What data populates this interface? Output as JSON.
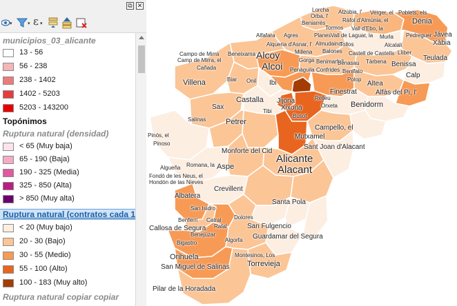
{
  "panel": {
    "window_buttons": [
      "⧉",
      "✕"
    ],
    "toolbar_icons": [
      "eye-icon",
      "filter-icon",
      "expression-icon",
      "expand-all-icon",
      "collapse-all-icon",
      "remove-layer-icon"
    ],
    "layers": {
      "municipios": {
        "name": "municipios_03_alicante",
        "classes": [
          {
            "label": "13 - 56",
            "color": "#ffffff"
          },
          {
            "label": "56 - 238",
            "color": "#f4b6b6"
          },
          {
            "label": "238 - 1402",
            "color": "#ee7a7a"
          },
          {
            "label": "1402 - 5203",
            "color": "#e83c3c"
          },
          {
            "label": "5203 - 143200",
            "color": "#e60000"
          }
        ]
      },
      "toponimos": {
        "name": "Topónimos"
      },
      "densidad": {
        "name": "Ruptura natural (densidad)",
        "classes": [
          {
            "label": "< 65 (Muy baja)",
            "color": "#fde4ec"
          },
          {
            "label": "65 - 190 (Baja)",
            "color": "#f4acc4"
          },
          {
            "label": "190 - 325 (Media)",
            "color": "#e05aa0"
          },
          {
            "label": "325 - 850 (Alta)",
            "color": "#b8207f"
          },
          {
            "label": "> 850 (Muy alta)",
            "color": "#6a006e"
          }
        ]
      },
      "contratos": {
        "name": "Ruptura natural (contratos cada 10",
        "classes": [
          {
            "label": "< 20 (Muy bajo)",
            "color": "#fdeee2"
          },
          {
            "label": "20 - 30 (Bajo)",
            "color": "#fbc596"
          },
          {
            "label": "30 - 55 (Medio)",
            "color": "#f79a55"
          },
          {
            "label": "55 - 100 (Alto)",
            "color": "#e8651f"
          },
          {
            "label": "100 - 183 (Muy alto)",
            "color": "#a33d05"
          }
        ]
      },
      "copia": {
        "name": "Ruptura natural copiar copiar"
      }
    }
  },
  "map": {
    "labels": [
      {
        "text": "Lorcha",
        "size": "s8"
      },
      {
        "text": "Orba, l'",
        "size": "s8"
      },
      {
        "text": "Atzúbia, l'",
        "size": "s8"
      },
      {
        "text": "Verger, el",
        "size": "s8"
      },
      {
        "text": "Poblets, els",
        "size": "s8"
      },
      {
        "text": "Beniarrés",
        "size": "s8"
      },
      {
        "text": "Ràfol d'Almúnia, el",
        "size": "s8"
      },
      {
        "text": "Dénia",
        "size": "s11"
      },
      {
        "text": "Tormos",
        "size": "s8"
      },
      {
        "text": "Vall d'Ebo, la",
        "size": "s8"
      },
      {
        "text": "Alfafara",
        "size": "s8"
      },
      {
        "text": "Agres",
        "size": "s8"
      },
      {
        "text": "Planes",
        "size": "s8"
      },
      {
        "text": "Vall de Laguar, la",
        "size": "s8"
      },
      {
        "text": "Murla",
        "size": "s8"
      },
      {
        "text": "Pedreguer",
        "size": "s8"
      },
      {
        "text": "Jávea",
        "size": "s10"
      },
      {
        "text": "Alqueria d'Asnar, l'",
        "size": "s8"
      },
      {
        "text": "Almudaina",
        "size": "s8"
      },
      {
        "text": "Tollos",
        "size": "s8"
      },
      {
        "text": "Alcalalí",
        "size": "s8"
      },
      {
        "text": "Xàbia",
        "size": "s10"
      },
      {
        "text": "Campo de Mirra",
        "size": "s8"
      },
      {
        "text": "Beneixama",
        "size": "s8"
      },
      {
        "text": "Millena",
        "size": "s8"
      },
      {
        "text": "Balones",
        "size": "s8"
      },
      {
        "text": "Castell de Castells",
        "size": "s8"
      },
      {
        "text": "Llíber",
        "size": "s8"
      },
      {
        "text": "Camp de Mirra, el",
        "size": "s8"
      },
      {
        "text": "Alcoy",
        "size": "s14"
      },
      {
        "text": "Gorga",
        "size": "s8"
      },
      {
        "text": "Benimarfull",
        "size": "s8"
      },
      {
        "text": "Benasau",
        "size": "s8"
      },
      {
        "text": "Tàrbena",
        "size": "s8"
      },
      {
        "text": "Teulada",
        "size": "s10"
      },
      {
        "text": "Cañada",
        "size": "s8"
      },
      {
        "text": "Alcoi",
        "size": "s14"
      },
      {
        "text": "Benissa",
        "size": "s10"
      },
      {
        "text": "Benifato",
        "size": "s8"
      },
      {
        "text": "Penàguila",
        "size": "s8"
      },
      {
        "text": "Confrides",
        "size": "s8"
      },
      {
        "text": "Calp",
        "size": "s10"
      },
      {
        "text": "Polop",
        "size": "s8"
      },
      {
        "text": "Villena",
        "size": "s11"
      },
      {
        "text": "Biar",
        "size": "s8"
      },
      {
        "text": "Onil",
        "size": "s8"
      },
      {
        "text": "Ibi",
        "size": "s10"
      },
      {
        "text": "Altea",
        "size": "s10"
      },
      {
        "text": "Finestrat",
        "size": "s10"
      },
      {
        "text": "Alfàs del Pi, l'",
        "size": "s10"
      },
      {
        "text": "Castalla",
        "size": "s11"
      },
      {
        "text": "Relleu",
        "size": "s8"
      },
      {
        "text": "Jijona",
        "size": "s10"
      },
      {
        "text": "Orxeta",
        "size": "s8"
      },
      {
        "text": "Benidorm",
        "size": "s11"
      },
      {
        "text": "Sax",
        "size": "s10"
      },
      {
        "text": "Tibi",
        "size": "s8"
      },
      {
        "text": "Xixona",
        "size": "s10"
      },
      {
        "text": "Busot",
        "size": "s8"
      },
      {
        "text": "Salinas",
        "size": "s8"
      },
      {
        "text": "Petrer",
        "size": "s11"
      },
      {
        "text": "Campello, el",
        "size": "s10"
      },
      {
        "text": "Pinós, el",
        "size": "s8"
      },
      {
        "text": "Mutxamel",
        "size": "s10"
      },
      {
        "text": "Pinoso",
        "size": "s8"
      },
      {
        "text": "Sant Joan d'Alacant",
        "size": "s10"
      },
      {
        "text": "Monforte del Cid",
        "size": "s10"
      },
      {
        "text": "Alicante",
        "size": "s15"
      },
      {
        "text": "Romana, la",
        "size": "s8"
      },
      {
        "text": "Algueña",
        "size": "s8"
      },
      {
        "text": "Aspe",
        "size": "s11"
      },
      {
        "text": "Alacant",
        "size": "s15"
      },
      {
        "text": "Fondó de les Neus, el",
        "size": "s8"
      },
      {
        "text": "Hondón de las Nieves",
        "size": "s8"
      },
      {
        "text": "Crevillent",
        "size": "s10"
      },
      {
        "text": "Albatera",
        "size": "s10"
      },
      {
        "text": "Santa Pola",
        "size": "s10"
      },
      {
        "text": "San Isidro",
        "size": "s8"
      },
      {
        "text": "Benferri",
        "size": "s8"
      },
      {
        "text": "Catral",
        "size": "s8"
      },
      {
        "text": "Dolores",
        "size": "s8"
      },
      {
        "text": "Callosa de Segura",
        "size": "s10"
      },
      {
        "text": "Rafal",
        "size": "s8"
      },
      {
        "text": "San Fulgencio",
        "size": "s10"
      },
      {
        "text": "Benejúzar",
        "size": "s8"
      },
      {
        "text": "Guardamar del Segura",
        "size": "s10"
      },
      {
        "text": "Bigastro",
        "size": "s8"
      },
      {
        "text": "Algorfa",
        "size": "s8"
      },
      {
        "text": "Orihuela",
        "size": "s11"
      },
      {
        "text": "Montesinos, Los",
        "size": "s8"
      },
      {
        "text": "Torrevieja",
        "size": "s11"
      },
      {
        "text": "San Miguel de Salinas",
        "size": "s10"
      },
      {
        "text": "Pilar de la Horadada",
        "size": "s10"
      }
    ]
  }
}
